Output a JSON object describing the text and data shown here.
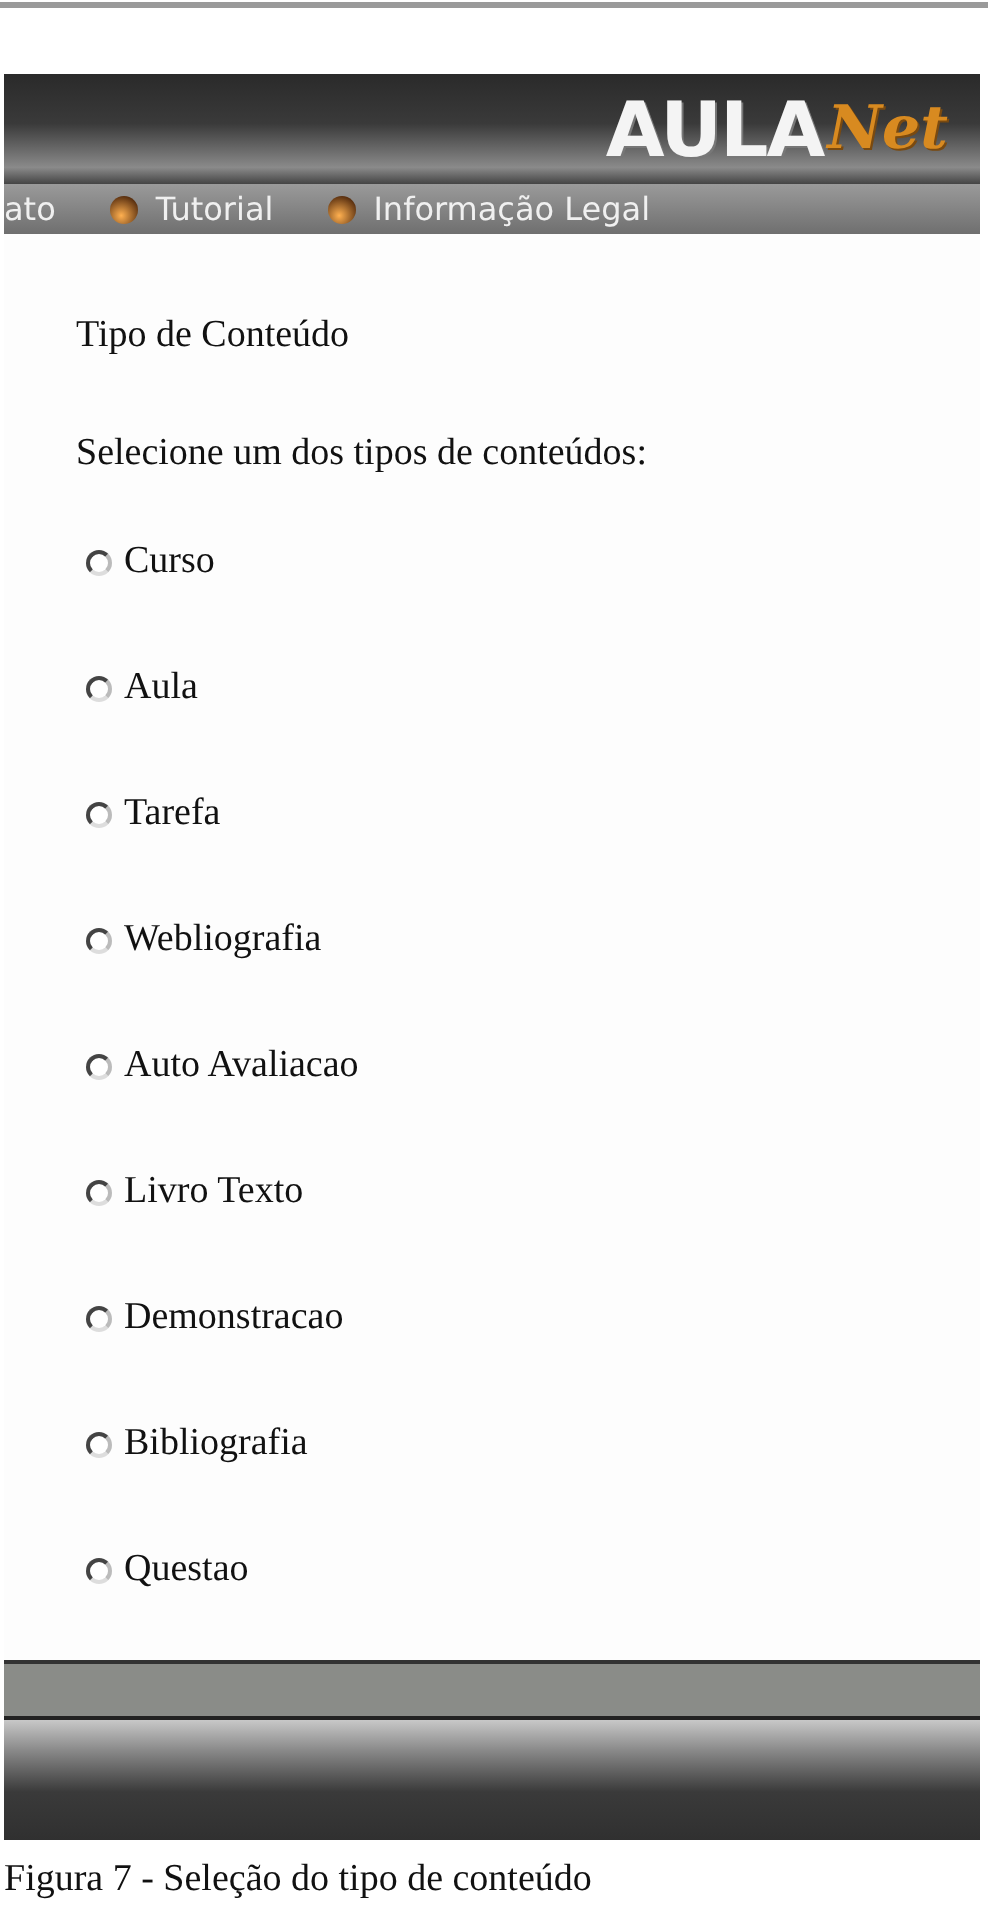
{
  "header": {
    "logo": {
      "main": "AULA",
      "script": "Net"
    }
  },
  "menu": [
    {
      "label": "ato",
      "bullet": false
    },
    {
      "label": "Tutorial",
      "bullet": true
    },
    {
      "label": "Informação Legal",
      "bullet": true
    }
  ],
  "content": {
    "title": "Tipo de Conteúdo",
    "prompt": "Selecione um dos tipos de conteúdos:",
    "options": [
      {
        "label": "Curso",
        "selected": false
      },
      {
        "label": "Aula",
        "selected": false
      },
      {
        "label": "Tarefa",
        "selected": false
      },
      {
        "label": "Webliografia",
        "selected": false
      },
      {
        "label": "Auto Avaliacao",
        "selected": false
      },
      {
        "label": "Livro Texto",
        "selected": false
      },
      {
        "label": "Demonstracao",
        "selected": false
      },
      {
        "label": "Bibliografia",
        "selected": false
      },
      {
        "label": "Questao",
        "selected": false
      }
    ]
  },
  "caption": "Figura 7 - Seleção do tipo de conteúdo"
}
